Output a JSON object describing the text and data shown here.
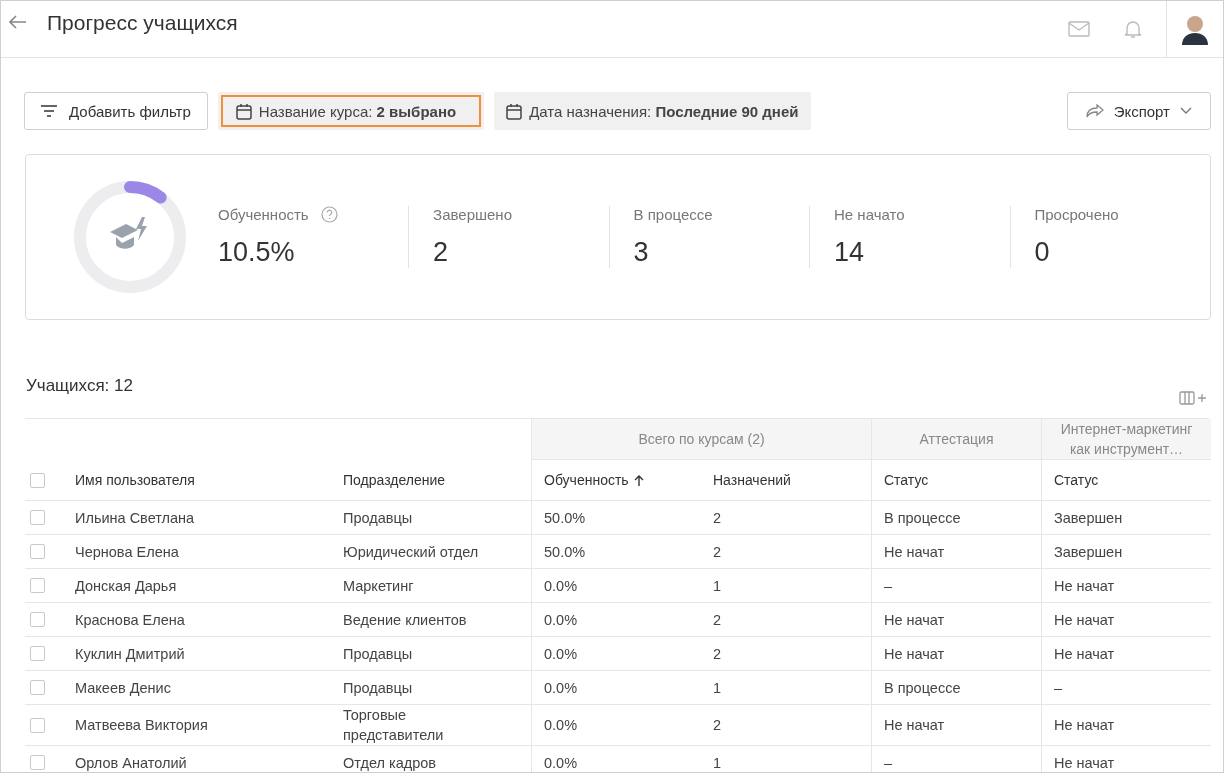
{
  "header": {
    "title": "Прогресс учащихся"
  },
  "filters": [
    {
      "kind": "button",
      "label": "Добавить фильтр",
      "highlighted": false
    },
    {
      "kind": "chip",
      "label": "Название курса: **2 выбрано**",
      "highlighted": true
    },
    {
      "kind": "chip",
      "label": "Дата назначения: **Последние 90 дней**",
      "highlighted": false
    }
  ],
  "export_button": {
    "label": "Экспорт"
  },
  "summary": {
    "level": 0.105,
    "stats": [
      {
        "label": "Обученность",
        "value": "10.5%",
        "help": true
      },
      {
        "label": "Завершено",
        "value": "2",
        "help": false
      },
      {
        "label": "В процессе",
        "value": "3",
        "help": false
      },
      {
        "label": "Не начато",
        "value": "14",
        "help": false
      },
      {
        "label": "Просрочено",
        "value": "0",
        "help": false
      }
    ]
  },
  "table": {
    "count_label": "Учащихся: 12",
    "select_all_checked": false,
    "groups": [
      {
        "label": "Всего по курсам (2)"
      },
      {
        "label": "Аттестация"
      },
      {
        "label": "Интернет-маркетинг как инструмент…"
      }
    ],
    "columns": [
      {
        "label": "Имя пользователя",
        "sorted": false
      },
      {
        "label": "Подразделение",
        "sorted": false
      },
      {
        "label": "Обученность",
        "sorted": true
      },
      {
        "label": "Назначений",
        "sorted": false
      },
      {
        "label": "Статус",
        "sorted": false
      },
      {
        "label": "Статус",
        "sorted": false
      }
    ],
    "rows": [
      {
        "checked": false,
        "cells": [
          "Ильина Светлана",
          "Продавцы",
          "50.0%",
          "2",
          "В процессе",
          "Завершен"
        ]
      },
      {
        "checked": false,
        "cells": [
          "Чернова Елена",
          "Юридический отдел",
          "50.0%",
          "2",
          "Не начат",
          "Завершен"
        ]
      },
      {
        "checked": false,
        "cells": [
          "Донская Дарья",
          "Маркетинг",
          "0.0%",
          "1",
          "–",
          "Не начат"
        ]
      },
      {
        "checked": false,
        "cells": [
          "Краснова Елена",
          "Ведение клиентов",
          "0.0%",
          "2",
          "Не начат",
          "Не начат"
        ]
      },
      {
        "checked": false,
        "cells": [
          "Куклин Дмитрий",
          "Продавцы",
          "0.0%",
          "2",
          "Не начат",
          "Не начат"
        ]
      },
      {
        "checked": false,
        "cells": [
          "Макеев Денис",
          "Продавцы",
          "0.0%",
          "1",
          "В процессе",
          "–"
        ]
      },
      {
        "checked": false,
        "cells": [
          "Матвеева Виктория",
          "Торговые представители",
          "0.0%",
          "2",
          "Не начат",
          "Не начат"
        ]
      },
      {
        "checked": false,
        "cells": [
          "Орлов Анатолий",
          "Отдел кадров",
          "0.0%",
          "1",
          "–",
          "Не начат"
        ]
      }
    ]
  }
}
